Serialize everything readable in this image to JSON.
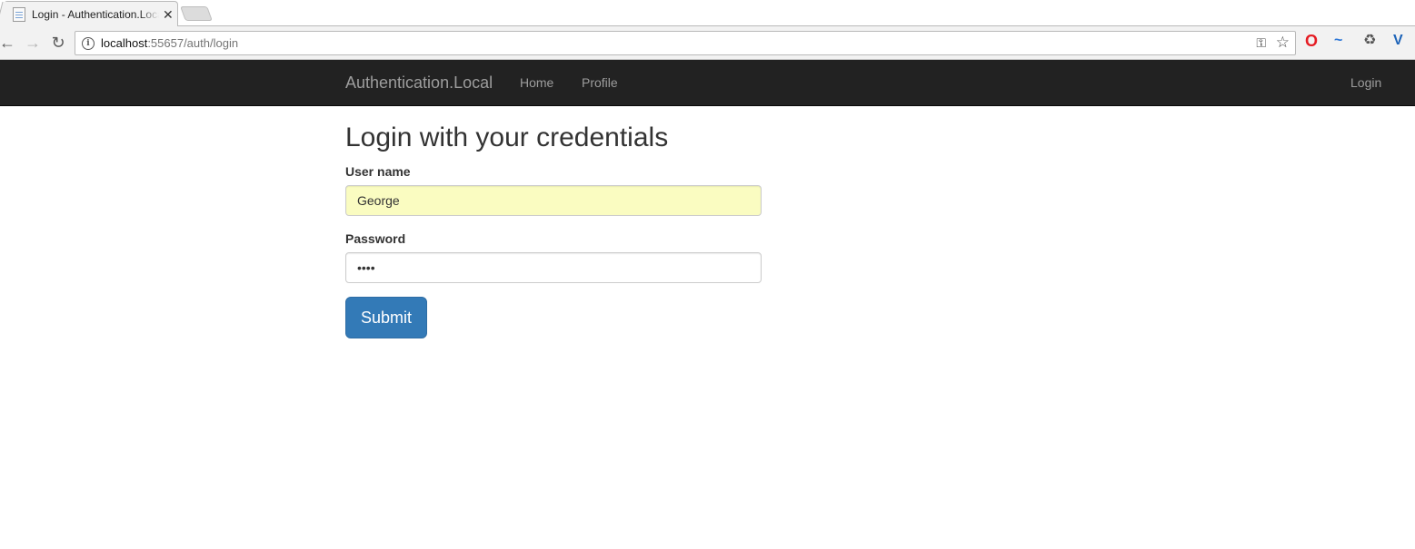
{
  "browser": {
    "tab_title": "Login - Authentication.Local",
    "tab_close": "✕",
    "url_host": "localhost",
    "url_rest": ":55657/auth/login"
  },
  "navbar": {
    "brand": "Authentication.Local",
    "home": "Home",
    "profile": "Profile",
    "login": "Login"
  },
  "form": {
    "heading": "Login with your credentials",
    "username_label": "User name",
    "username_value": "George",
    "password_label": "Password",
    "password_value": "••••",
    "submit_label": "Submit"
  },
  "colors": {
    "navbar_bg": "#222222",
    "button_primary": "#337ab7",
    "autofill_bg": "#fafcc1"
  }
}
